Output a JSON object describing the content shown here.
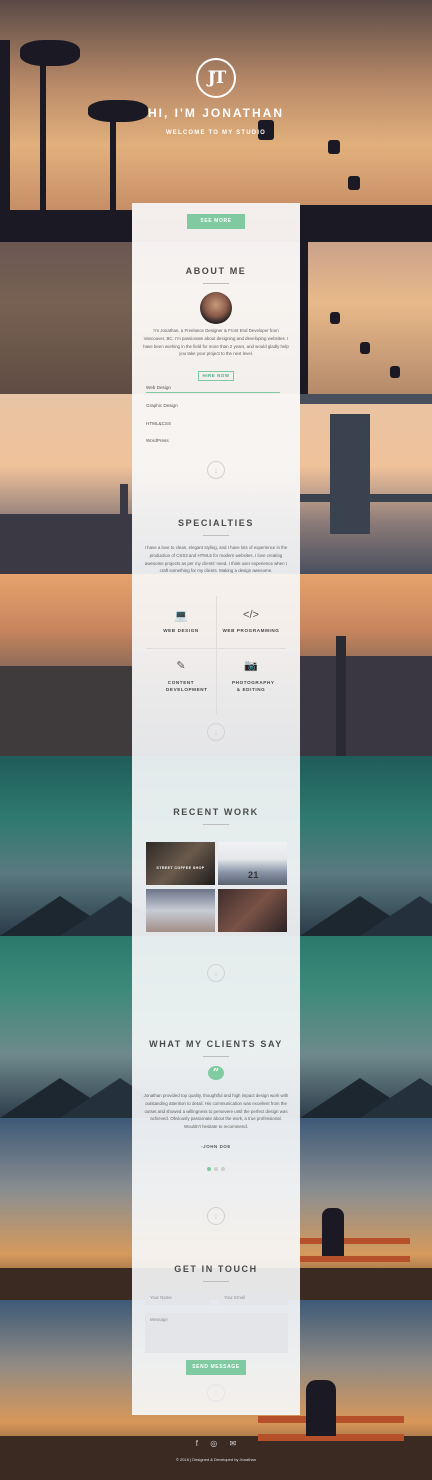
{
  "hero": {
    "logo_text": "JT",
    "title": "HI, I'M JONATHAN",
    "subtitle": "WELCOME TO MY STUDIO",
    "see_more": "SEE MORE"
  },
  "about": {
    "title": "ABOUT ME",
    "text": "I'm Jonathan, a Freelance Designer & Front End Developer from Vancouver, BC. I'm passionate about designing and developing websites. I have been working in the field for more than 2 years, and would gladly help you take your project to the next level.",
    "hire_label": "HIRE NOW",
    "skills": [
      "Web Design",
      "Graphic Design",
      "HTML&CSS",
      "WordPress"
    ]
  },
  "specialties": {
    "title": "SPECIALTIES",
    "text": "I have a love to clean, elegant styling, and I have lots of experience in the production of CSS3 and HTML5 for modern websites. I love creating awesome projects as per my clients' need. I think user experience when I craft something for my clients. Making a design awesome.",
    "items": [
      {
        "icon": "laptop-icon",
        "glyph": "💻",
        "label": "WEB DESIGN"
      },
      {
        "icon": "code-icon",
        "glyph": "</>",
        "label": "WEB PROGRAMMING"
      },
      {
        "icon": "pencil-icon",
        "glyph": "✎",
        "label": "CONTENT DEVELOPMENT"
      },
      {
        "icon": "camera-icon",
        "glyph": "📷",
        "label": "PHOTOGRAPHY & EDITING"
      }
    ]
  },
  "recent_work": {
    "title": "RECENT WORK",
    "tiles": [
      {
        "caption": "STREET COFFEE SHOP",
        "badge": ""
      },
      {
        "caption": "",
        "badge": "21"
      },
      {
        "caption": "",
        "badge": ""
      },
      {
        "caption": "",
        "badge": ""
      }
    ]
  },
  "clients": {
    "title": "WHAT MY CLIENTS SAY",
    "quote_glyph": "”",
    "quote": "Jonathan provided top quality, thoughtful and high impact design work with outstanding attention to detail. His communication was excellent from the outset and showed a willingness to persevere until the perfect design was achieved. Obviously passionate about the work, a true professional. Wouldn't hesitate to recommend.",
    "author": "-JOHN DOE"
  },
  "contact": {
    "title": "GET IN TOUCH",
    "name_placeholder": "Your Name",
    "email_placeholder": "Your Email",
    "message_placeholder": "Message",
    "send_label": "SEND MESSAGE"
  },
  "footer": {
    "icons": [
      "facebook-icon",
      "instagram-icon",
      "mail-icon"
    ],
    "icon_glyphs": [
      "f",
      "◎",
      "✉"
    ],
    "copyright": "© 2016 | Designed & Developed by Jonathan"
  },
  "colors": {
    "accent": "#7fcaa0",
    "panel": "#f8f9fb"
  }
}
